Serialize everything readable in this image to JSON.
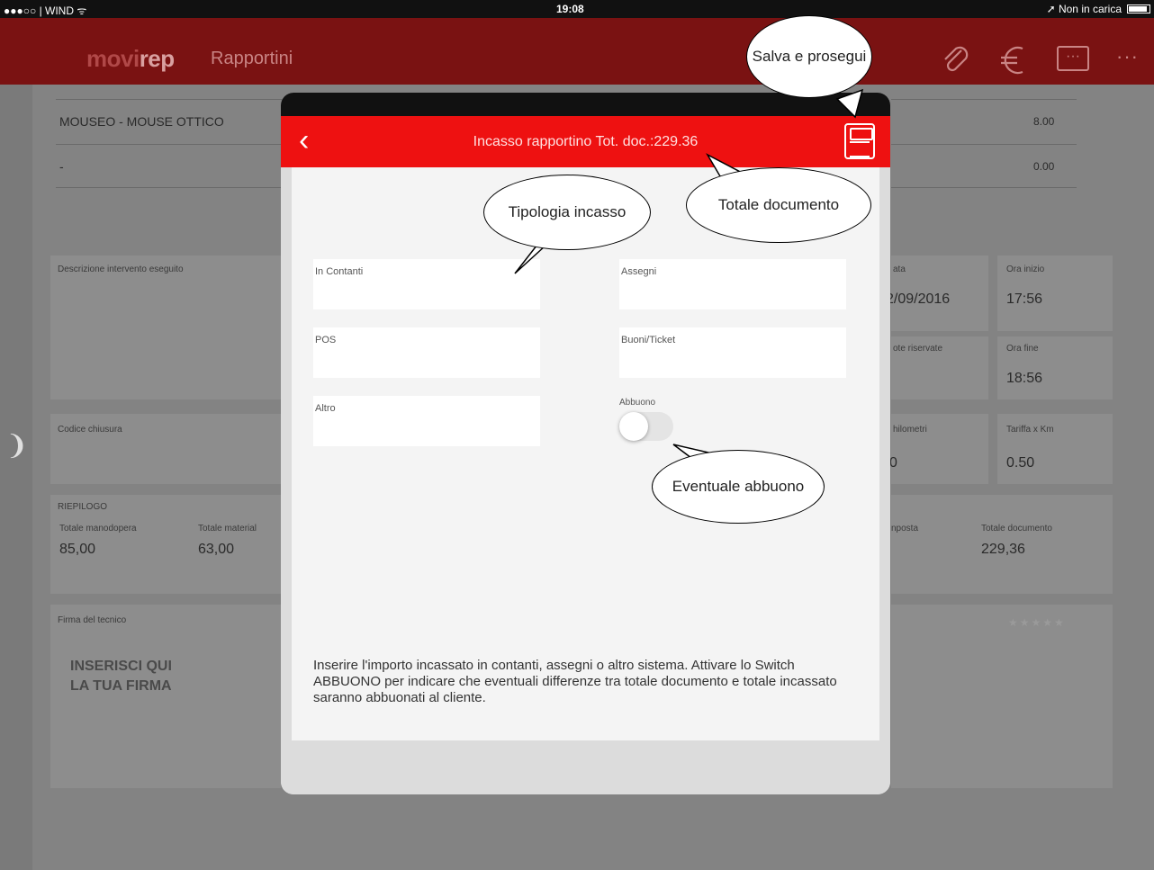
{
  "status_bar": {
    "carrier": "●●●○○ | WIND ᯤ",
    "time": "19:08",
    "charging": "➚ Non in carica"
  },
  "navbar": {
    "logo_brand": "movi",
    "logo_rep": "rep",
    "title": "Rapportini",
    "chat_icon_text": "···",
    "more_icon": "···"
  },
  "background": {
    "rows": [
      {
        "label": "MOUSEO - MOUSE OTTICO",
        "value": "8.00"
      },
      {
        "label": "-",
        "value": "0.00"
      }
    ],
    "desc_label": "Descrizione intervento eseguito",
    "data_label": "ata",
    "data_value": "2/09/2016",
    "ora_inizio_label": "Ora inizio",
    "ora_inizio_value": "17:56",
    "note_label": "ote riservate",
    "ora_fine_label": "Ora fine",
    "ora_fine_value": "18:56",
    "codice_label": "Codice chiusura",
    "km_label": "hilometri",
    "km_value": "0",
    "tariffa_label": "Tariffa x Km",
    "tariffa_value": "0.50",
    "riepilogo_label": "RIEPILOGO",
    "manodopera_label": "Totale manodopera",
    "manodopera_value": "85,00",
    "materiali_label": "Totale material",
    "materiali_value": "63,00",
    "imposta_label": "nposta",
    "totale_doc_label": "Totale documento",
    "totale_doc_value": "229,36",
    "firma_label": "Firma del tecnico",
    "sign_line1": "INSERISCI QUI",
    "sign_line2": "LA TUA FIRMA",
    "side_handle": "❩"
  },
  "modal": {
    "back_icon": "‹",
    "title": "Incasso rapportino Tot. doc.:229.36",
    "fields": {
      "contanti": {
        "label": "In Contanti",
        "value": ""
      },
      "assegni": {
        "label": "Assegni",
        "value": ""
      },
      "pos": {
        "label": "POS",
        "value": ""
      },
      "buoni": {
        "label": "Buoni/Ticket",
        "value": ""
      },
      "altro": {
        "label": "Altro",
        "value": ""
      }
    },
    "abbuono_label": "Abbuono",
    "abbuono_on": false,
    "instructions": "Inserire l'importo incassato in contanti, assegni o altro sistema. Attivare lo Switch ABBUONO per indicare che eventuali differenze tra totale documento e totale incassato saranno abbuonati al cliente."
  },
  "callouts": {
    "salva": "Salva e prosegui",
    "tipologia": "Tipologia incasso",
    "totale": "Totale documento",
    "abbuono": "Eventuale abbuono"
  },
  "colors": {
    "header_red": "#ee1111",
    "nav_dim_red": "#7a1212"
  }
}
